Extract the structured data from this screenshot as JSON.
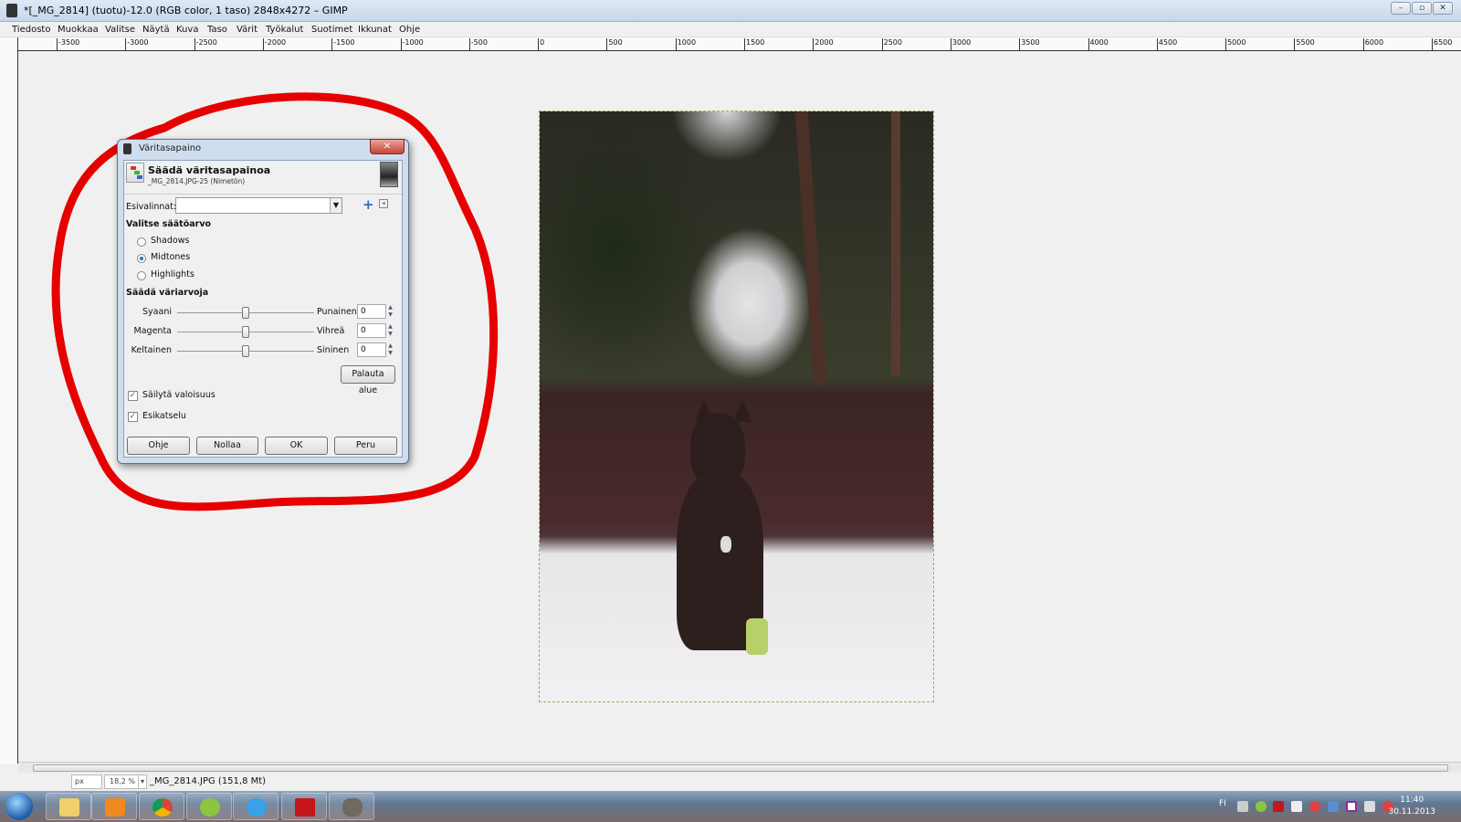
{
  "window": {
    "title": "*[_MG_2814] (tuotu)-12.0 (RGB color, 1 taso) 2848x4272 – GIMP",
    "controls": [
      "–",
      "▫",
      "✕"
    ]
  },
  "menu": [
    "Tiedosto",
    "Muokkaa",
    "Valitse",
    "Näytä",
    "Kuva",
    "Taso",
    "Värit",
    "Työkalut",
    "Suotimet",
    "Ikkunat",
    "Ohje"
  ],
  "ruler": {
    "labels": [
      "-3500",
      "-3000",
      "-2500",
      "-2000",
      "-1500",
      "-1000",
      "-500",
      "0",
      "500",
      "1000",
      "1500",
      "2000",
      "2500",
      "3000",
      "3500",
      "4000",
      "4500",
      "5000",
      "5500",
      "6000",
      "6500"
    ]
  },
  "dialog": {
    "window_title": "Väritasapaino",
    "close": "✕",
    "heading": "Säädä väritasapainoa",
    "subheading": "_MG_2814.JPG-25 (Nimetön)",
    "presets_label": "Esivalinnat:",
    "presets_value": "",
    "range_section": "Valitse säätöarvo",
    "ranges": [
      {
        "label": "Shadows",
        "selected": false
      },
      {
        "label": "Midtones",
        "selected": true
      },
      {
        "label": "Highlights",
        "selected": false
      }
    ],
    "adjust_section": "Säädä väriarvoja",
    "sliders": [
      {
        "left": "Syaani",
        "right": "Punainen",
        "value": "0"
      },
      {
        "left": "Magenta",
        "right": "Vihreä",
        "value": "0"
      },
      {
        "left": "Keltainen",
        "right": "Sininen",
        "value": "0"
      }
    ],
    "reset_range": "Palauta alue",
    "preserve_luminosity": {
      "label": "Säilytä valoisuus",
      "checked": true
    },
    "preview": {
      "label": "Esikatselu",
      "checked": true
    },
    "buttons": {
      "help": "Ohje",
      "reset": "Nollaa",
      "ok": "OK",
      "cancel": "Peru"
    }
  },
  "status": {
    "unit": "px",
    "zoom": "18,2 %",
    "file_info": "_MG_2814.JPG (151,8 Mt)"
  },
  "taskbar": {
    "apps": [
      "explorer",
      "media-player",
      "chrome",
      "spotify",
      "internet-explorer",
      "acrobat",
      "gimp"
    ],
    "lang": "FI",
    "time": "11:40",
    "date": "30.11.2013"
  },
  "annotation_color": "#e60000"
}
